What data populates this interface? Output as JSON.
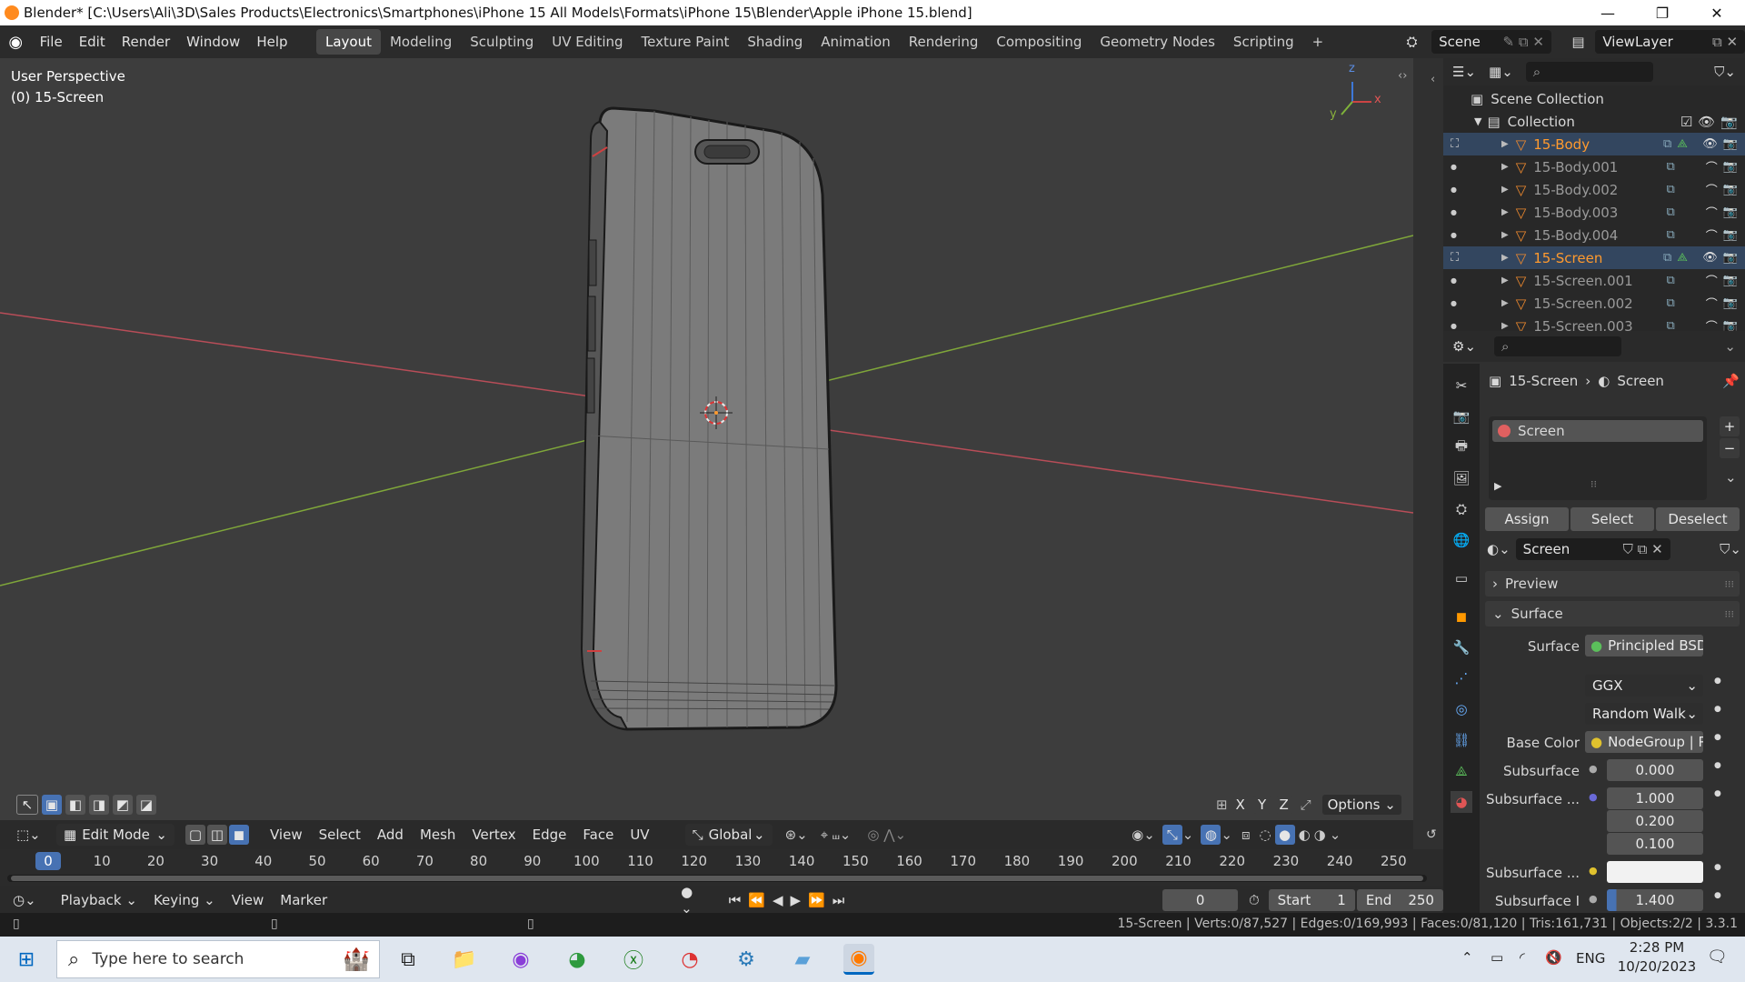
{
  "window": {
    "title": "Blender* [C:\\Users\\Ali\\3D\\Sales Products\\Electronics\\Smartphones\\iPhone 15 All Models\\Formats\\iPhone 15\\Blender\\Apple iPhone 15.blend]",
    "minimize": "—",
    "maximize": "❐",
    "close": "✕"
  },
  "menu": [
    "File",
    "Edit",
    "Render",
    "Window",
    "Help"
  ],
  "workspaces": [
    "Layout",
    "Modeling",
    "Sculpting",
    "UV Editing",
    "Texture Paint",
    "Shading",
    "Animation",
    "Rendering",
    "Compositing",
    "Geometry Nodes",
    "Scripting"
  ],
  "workspace_add": "+",
  "scene": {
    "label": "Scene",
    "view_layer": "ViewLayer"
  },
  "viewport": {
    "perspective": "User Perspective",
    "object_label": "(0) 15-Screen",
    "axis_x": "x",
    "axis_y": "y",
    "axis_z": "z"
  },
  "viewport_header": {
    "mode": "Edit Mode",
    "menus": [
      "View",
      "Select",
      "Add",
      "Mesh",
      "Vertex",
      "Edge",
      "Face",
      "UV"
    ],
    "transform": "Global",
    "options": "Options",
    "axes": [
      "X",
      "Y",
      "Z"
    ]
  },
  "outliner": {
    "root": "Scene Collection",
    "collection": "Collection",
    "items": [
      {
        "name": "15-Body",
        "selected": true
      },
      {
        "name": "15-Body.001",
        "selected": false
      },
      {
        "name": "15-Body.002",
        "selected": false
      },
      {
        "name": "15-Body.003",
        "selected": false
      },
      {
        "name": "15-Body.004",
        "selected": false
      },
      {
        "name": "15-Screen",
        "selected": true
      },
      {
        "name": "15-Screen.001",
        "selected": false
      },
      {
        "name": "15-Screen.002",
        "selected": false
      },
      {
        "name": "15-Screen.003",
        "selected": false
      }
    ]
  },
  "properties": {
    "breadcrumb_object": "15-Screen",
    "breadcrumb_material": "Screen",
    "slot": "Screen",
    "assign": "Assign",
    "select": "Select",
    "deselect": "Deselect",
    "material_name": "Screen",
    "preview": "Preview",
    "surface_section": "Surface",
    "surface_label": "Surface",
    "surface_value": "Principled BSDF",
    "distribution": "GGX",
    "subsurface_method": "Random Walk",
    "base_color_label": "Base Color",
    "base_color_value": "NodeGroup | Pi...",
    "subsurface_label": "Subsurface",
    "subsurface_value": "0.000",
    "subsurface_radius_label": "Subsurface ...",
    "subsurface_radius": [
      "1.000",
      "0.200",
      "0.100"
    ],
    "subsurface_color_label": "Subsurface ...",
    "subsurface_ior_label": "Subsurface I",
    "subsurface_ior": "1.400"
  },
  "timeline": {
    "ticks": [
      "0",
      "10",
      "20",
      "30",
      "40",
      "50",
      "60",
      "70",
      "80",
      "90",
      "100",
      "110",
      "120",
      "130",
      "140",
      "150",
      "160",
      "170",
      "180",
      "190",
      "200",
      "210",
      "220",
      "230",
      "240",
      "250"
    ],
    "playback": "Playback",
    "keying": "Keying",
    "view": "View",
    "marker": "Marker",
    "current_frame": "0",
    "start_label": "Start",
    "start": "1",
    "end_label": "End",
    "end": "250"
  },
  "statusbar": {
    "text": "15-Screen | Verts:0/87,527 | Edges:0/169,993 | Faces:0/81,120 | Tris:161,731 | Objects:2/2 | 3.3.1"
  },
  "taskbar": {
    "search_placeholder": "Type here to search",
    "lang": "ENG",
    "time": "2:28 PM",
    "date": "10/20/2023"
  },
  "colors": {
    "accent": "#ff9a2e",
    "selection": "#4772b3",
    "viewport_bg": "#3d3d3d",
    "x_axis": "#c4515c",
    "y_axis": "#8ab23c"
  }
}
